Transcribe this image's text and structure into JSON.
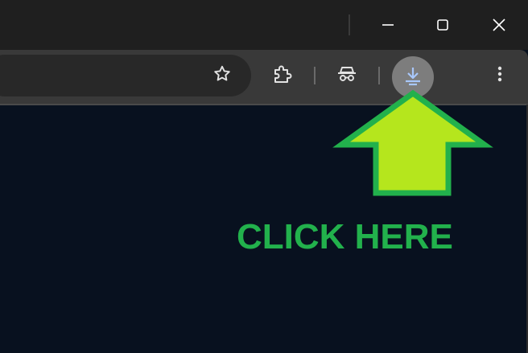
{
  "window_controls": {
    "minimize_icon": "minimize-icon",
    "maximize_icon": "maximize-icon",
    "close_icon": "close-icon"
  },
  "toolbar": {
    "bookmark_icon": "star-icon",
    "extensions_icon": "puzzle-icon",
    "incognito_icon": "incognito-icon",
    "download_icon": "download-icon",
    "menu_icon": "kebab-menu-icon"
  },
  "annotation": {
    "text": "CLICK HERE",
    "text_color": "#22b14c",
    "arrow_fill": "#b5e61d",
    "arrow_stroke": "#22b14c"
  },
  "colors": {
    "titlebar": "#1f1f1f",
    "toolbar": "#393939",
    "omnibox": "#282828",
    "content_bg": "#08111f",
    "download_button": "#7d7d7d",
    "download_icon": "#a8c7fa"
  }
}
